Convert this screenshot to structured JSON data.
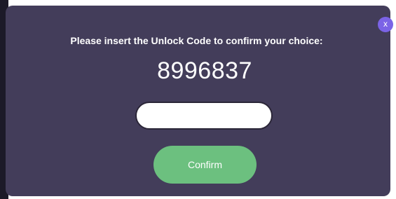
{
  "dialog": {
    "close_label": "x",
    "prompt": "Please insert the Unlock Code to confirm your choice:",
    "unlock_code": "8996837",
    "input": {
      "value": "",
      "placeholder": ""
    },
    "confirm_label": "Confirm"
  },
  "colors": {
    "modal_background": "#433d5a",
    "close_button": "#7b63e6",
    "confirm_button": "#6cc07f",
    "text": "#ffffff"
  },
  "icons": {
    "close": "close-icon"
  }
}
